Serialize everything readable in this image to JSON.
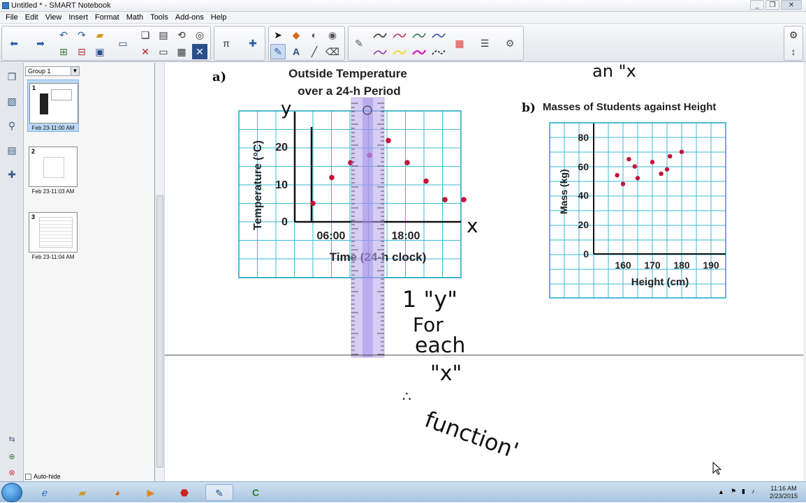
{
  "window": {
    "title": "Untitled * - SMART Notebook",
    "controls": [
      "_",
      "❐",
      "✕"
    ]
  },
  "menu": [
    "File",
    "Edit",
    "View",
    "Insert",
    "Format",
    "Math",
    "Tools",
    "Add-ons",
    "Help"
  ],
  "sorter": {
    "group_name": "Group 1",
    "pages": [
      {
        "num": "1",
        "date": "Feb 23-11:00 AM",
        "selected": true
      },
      {
        "num": "2",
        "date": "Feb 23-11:03 AM",
        "selected": false
      },
      {
        "num": "3",
        "date": "Feb 23-11:04 AM",
        "selected": false
      }
    ],
    "autohide_label": "Auto-hide"
  },
  "page": {
    "graph_a": {
      "letter": "a)",
      "title_line1": "Outside Temperature",
      "title_line2": "over a 24-h Period",
      "ylabel": "Temperature (°C)",
      "xlabel": "Time (24-h clock)",
      "yticks": [
        "0",
        "10",
        "20"
      ],
      "xticks": [
        "06:00",
        "18:00"
      ]
    },
    "graph_b": {
      "letter": "b)",
      "title": "Masses of Students against Height",
      "ylabel": "Mass (kg)",
      "xlabel": "Height (cm)",
      "yticks": [
        "0",
        "20",
        "40",
        "60",
        "80"
      ],
      "xticks": [
        "160",
        "170",
        "180",
        "190"
      ]
    },
    "ink": {
      "top_fragment": "an \"x",
      "y_axis_mark": "y",
      "x_axis_mark": "x",
      "note_line1": "1 \"y\"",
      "note_line2": "For",
      "note_line3": "each",
      "note_line4": "\"x\"",
      "note_therefore": "∴",
      "note_function": "function'"
    }
  },
  "taskbar": {
    "time": "11:16 AM",
    "date": "2/23/2015"
  },
  "chart_data": [
    {
      "type": "scatter",
      "title": "Outside Temperature over a 24-h Period",
      "xlabel": "Time (24-h clock)",
      "ylabel": "Temperature (°C)",
      "x_tick_labels": [
        "06:00",
        "18:00"
      ],
      "ylim": [
        0,
        25
      ],
      "series": [
        {
          "x": [
            "00:00",
            "03:00",
            "06:00",
            "09:00",
            "12:00",
            "15:00",
            "18:00",
            "21:00",
            "24:00"
          ],
          "y": [
            5,
            12,
            16,
            18,
            22,
            16,
            11,
            6,
            6
          ]
        }
      ]
    },
    {
      "type": "scatter",
      "title": "Masses of Students against Height",
      "xlabel": "Height (cm)",
      "ylabel": "Mass (kg)",
      "xlim": [
        150,
        190
      ],
      "ylim": [
        0,
        80
      ],
      "series": [
        {
          "x": [
            158,
            160,
            162,
            164,
            165,
            170,
            173,
            175,
            176,
            180
          ],
          "y": [
            54,
            48,
            65,
            60,
            52,
            63,
            55,
            58,
            67,
            70
          ]
        }
      ]
    }
  ]
}
